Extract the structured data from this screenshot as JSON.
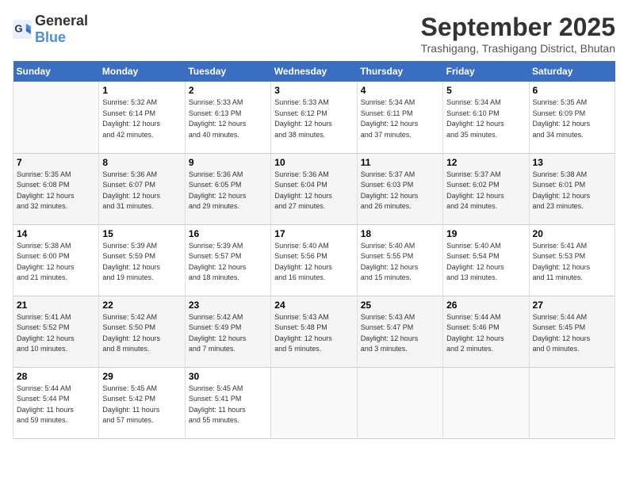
{
  "header": {
    "logo_general": "General",
    "logo_blue": "Blue",
    "month_title": "September 2025",
    "location": "Trashigang, Trashigang District, Bhutan"
  },
  "weekdays": [
    "Sunday",
    "Monday",
    "Tuesday",
    "Wednesday",
    "Thursday",
    "Friday",
    "Saturday"
  ],
  "weeks": [
    [
      {
        "day": "",
        "info": ""
      },
      {
        "day": "1",
        "info": "Sunrise: 5:32 AM\nSunset: 6:14 PM\nDaylight: 12 hours\nand 42 minutes."
      },
      {
        "day": "2",
        "info": "Sunrise: 5:33 AM\nSunset: 6:13 PM\nDaylight: 12 hours\nand 40 minutes."
      },
      {
        "day": "3",
        "info": "Sunrise: 5:33 AM\nSunset: 6:12 PM\nDaylight: 12 hours\nand 38 minutes."
      },
      {
        "day": "4",
        "info": "Sunrise: 5:34 AM\nSunset: 6:11 PM\nDaylight: 12 hours\nand 37 minutes."
      },
      {
        "day": "5",
        "info": "Sunrise: 5:34 AM\nSunset: 6:10 PM\nDaylight: 12 hours\nand 35 minutes."
      },
      {
        "day": "6",
        "info": "Sunrise: 5:35 AM\nSunset: 6:09 PM\nDaylight: 12 hours\nand 34 minutes."
      }
    ],
    [
      {
        "day": "7",
        "info": "Sunrise: 5:35 AM\nSunset: 6:08 PM\nDaylight: 12 hours\nand 32 minutes."
      },
      {
        "day": "8",
        "info": "Sunrise: 5:36 AM\nSunset: 6:07 PM\nDaylight: 12 hours\nand 31 minutes."
      },
      {
        "day": "9",
        "info": "Sunrise: 5:36 AM\nSunset: 6:05 PM\nDaylight: 12 hours\nand 29 minutes."
      },
      {
        "day": "10",
        "info": "Sunrise: 5:36 AM\nSunset: 6:04 PM\nDaylight: 12 hours\nand 27 minutes."
      },
      {
        "day": "11",
        "info": "Sunrise: 5:37 AM\nSunset: 6:03 PM\nDaylight: 12 hours\nand 26 minutes."
      },
      {
        "day": "12",
        "info": "Sunrise: 5:37 AM\nSunset: 6:02 PM\nDaylight: 12 hours\nand 24 minutes."
      },
      {
        "day": "13",
        "info": "Sunrise: 5:38 AM\nSunset: 6:01 PM\nDaylight: 12 hours\nand 23 minutes."
      }
    ],
    [
      {
        "day": "14",
        "info": "Sunrise: 5:38 AM\nSunset: 6:00 PM\nDaylight: 12 hours\nand 21 minutes."
      },
      {
        "day": "15",
        "info": "Sunrise: 5:39 AM\nSunset: 5:59 PM\nDaylight: 12 hours\nand 19 minutes."
      },
      {
        "day": "16",
        "info": "Sunrise: 5:39 AM\nSunset: 5:57 PM\nDaylight: 12 hours\nand 18 minutes."
      },
      {
        "day": "17",
        "info": "Sunrise: 5:40 AM\nSunset: 5:56 PM\nDaylight: 12 hours\nand 16 minutes."
      },
      {
        "day": "18",
        "info": "Sunrise: 5:40 AM\nSunset: 5:55 PM\nDaylight: 12 hours\nand 15 minutes."
      },
      {
        "day": "19",
        "info": "Sunrise: 5:40 AM\nSunset: 5:54 PM\nDaylight: 12 hours\nand 13 minutes."
      },
      {
        "day": "20",
        "info": "Sunrise: 5:41 AM\nSunset: 5:53 PM\nDaylight: 12 hours\nand 11 minutes."
      }
    ],
    [
      {
        "day": "21",
        "info": "Sunrise: 5:41 AM\nSunset: 5:52 PM\nDaylight: 12 hours\nand 10 minutes."
      },
      {
        "day": "22",
        "info": "Sunrise: 5:42 AM\nSunset: 5:50 PM\nDaylight: 12 hours\nand 8 minutes."
      },
      {
        "day": "23",
        "info": "Sunrise: 5:42 AM\nSunset: 5:49 PM\nDaylight: 12 hours\nand 7 minutes."
      },
      {
        "day": "24",
        "info": "Sunrise: 5:43 AM\nSunset: 5:48 PM\nDaylight: 12 hours\nand 5 minutes."
      },
      {
        "day": "25",
        "info": "Sunrise: 5:43 AM\nSunset: 5:47 PM\nDaylight: 12 hours\nand 3 minutes."
      },
      {
        "day": "26",
        "info": "Sunrise: 5:44 AM\nSunset: 5:46 PM\nDaylight: 12 hours\nand 2 minutes."
      },
      {
        "day": "27",
        "info": "Sunrise: 5:44 AM\nSunset: 5:45 PM\nDaylight: 12 hours\nand 0 minutes."
      }
    ],
    [
      {
        "day": "28",
        "info": "Sunrise: 5:44 AM\nSunset: 5:44 PM\nDaylight: 11 hours\nand 59 minutes."
      },
      {
        "day": "29",
        "info": "Sunrise: 5:45 AM\nSunset: 5:42 PM\nDaylight: 11 hours\nand 57 minutes."
      },
      {
        "day": "30",
        "info": "Sunrise: 5:45 AM\nSunset: 5:41 PM\nDaylight: 11 hours\nand 55 minutes."
      },
      {
        "day": "",
        "info": ""
      },
      {
        "day": "",
        "info": ""
      },
      {
        "day": "",
        "info": ""
      },
      {
        "day": "",
        "info": ""
      }
    ]
  ]
}
